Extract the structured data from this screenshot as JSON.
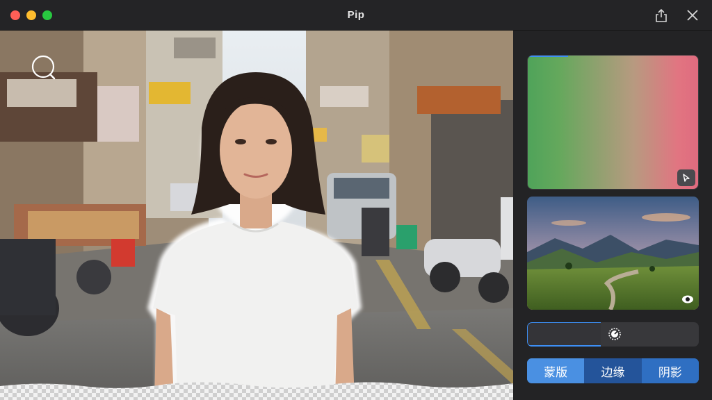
{
  "window": {
    "title": "Pip"
  },
  "canvas": {
    "subject": "woman-in-white-tshirt",
    "background_scene": "street-market",
    "transparency_grid": true
  },
  "panel": {
    "gradient_preview": {
      "colors": [
        "#4fa35a",
        "#e06b7f"
      ]
    },
    "background_preview": {
      "scene": "mountain-landscape"
    },
    "slider": {
      "value": 0.43
    },
    "segments": [
      {
        "label": "蒙版",
        "active": true
      },
      {
        "label": "边缘",
        "active": false
      },
      {
        "label": "阴影",
        "active": false
      }
    ]
  },
  "colors": {
    "accent": "#3d8ff5",
    "segment_active": "#4a90e2",
    "panel_bg": "#232325",
    "titlebar_bg": "#242426"
  },
  "icons": {
    "zoom": "search-icon",
    "share": "share-icon",
    "close": "close-icon",
    "picker": "cursor-arrow-icon",
    "visibility": "eye-icon",
    "slider_knob": "dial-icon"
  }
}
